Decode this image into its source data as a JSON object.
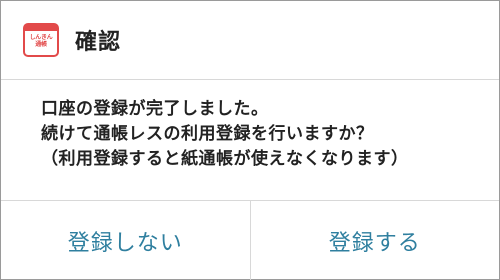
{
  "dialog": {
    "icon": {
      "name": "bank-app-icon",
      "text": "しんきん\n通帳",
      "color": "#e24a4a"
    },
    "title": "確認",
    "message": {
      "line1": "口座の登録が完了しました。",
      "line2": "続けて通帳レスの利用登録を行いますか？",
      "line3": "（利用登録すると紙通帳が使えなくなります）"
    },
    "buttons": {
      "decline_label": "登録しない",
      "accept_label": "登録する",
      "color": "#2f7f9f"
    }
  }
}
